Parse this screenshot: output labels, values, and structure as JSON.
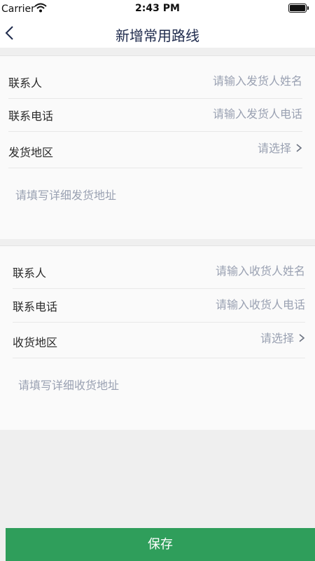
{
  "status_bar": {
    "carrier": "Carrier",
    "time": "2:43 PM"
  },
  "nav": {
    "title": "新增常用路线"
  },
  "sender": {
    "contact_label": "联系人",
    "contact_placeholder": "请输入发货人姓名",
    "phone_label": "联系电话",
    "phone_placeholder": "请输入发货人电话",
    "region_label": "发货地区",
    "region_placeholder": "请选择",
    "address_placeholder": "请填写详细发货地址"
  },
  "receiver": {
    "contact_label": "联系人",
    "contact_placeholder": "请输入收货人姓名",
    "phone_label": "联系电话",
    "phone_placeholder": "请输入收货人电话",
    "region_label": "收货地区",
    "region_placeholder": "请选择",
    "address_placeholder": "请填写详细收货地址"
  },
  "actions": {
    "save_label": "保存"
  },
  "colors": {
    "primary": "#2f9e5b",
    "placeholder": "#9aa1b2",
    "title": "#1f2b4d"
  }
}
